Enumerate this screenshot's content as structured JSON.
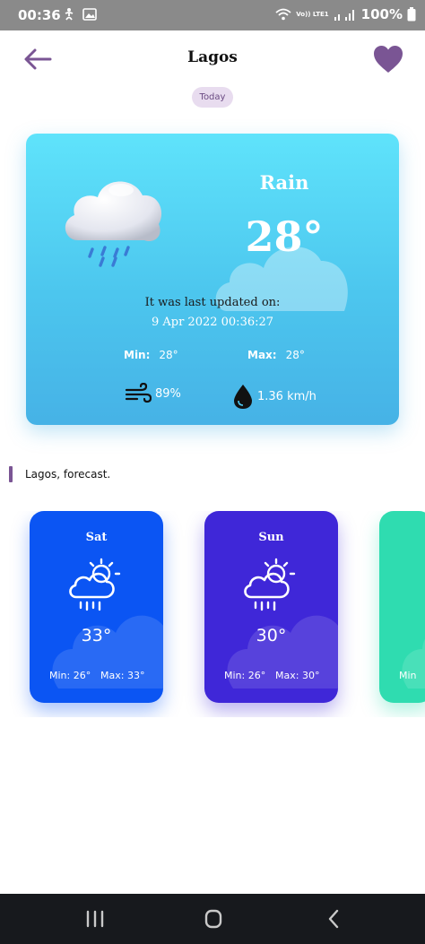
{
  "status_bar": {
    "time": "00:36",
    "network_label": "Vo)) LTE1",
    "battery": "100%"
  },
  "header": {
    "title": "Lagos",
    "chip": "Today"
  },
  "current": {
    "condition": "Rain",
    "temperature": "28°",
    "updated_label": "It was last updated on:",
    "updated_value": "9 Apr 2022 00:36:27",
    "min_label": "Min:",
    "min_value": "28°",
    "max_label": "Max:",
    "max_value": "28°",
    "humidity": "89%",
    "wind": "1.36 km/h"
  },
  "forecast": {
    "title": "Lagos, forecast.",
    "items": [
      {
        "day": "Sat",
        "temp": "33°",
        "min": "Min: 26°",
        "max": "Max: 33°"
      },
      {
        "day": "Sun",
        "temp": "30°",
        "min": "Min: 26°",
        "max": "Max: 30°"
      },
      {
        "min_peek": "Min"
      }
    ]
  },
  "colors": {
    "accent": "#7a5594",
    "card_gradient_top": "#5fe3fb",
    "card_gradient_bottom": "#46b2e6",
    "forecast_sat": "#0b55f3",
    "forecast_sun": "#3f27d8",
    "forecast_next": "#2fdcb0"
  },
  "icons": {
    "back": "arrow-left-icon",
    "favorite": "heart-icon",
    "main_weather": "rain-cloud-icon",
    "humidity": "wind-icon",
    "wind": "water-drop-icon",
    "forecast": "partly-cloudy-rain-icon"
  }
}
